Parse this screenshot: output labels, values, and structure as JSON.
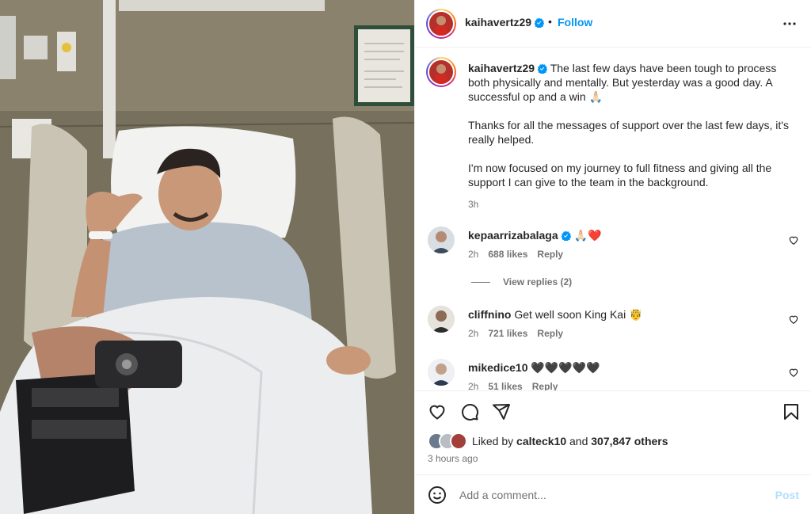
{
  "post": {
    "username": "kaihavertz29",
    "follow_label": "Follow",
    "separator": "•",
    "caption_paragraphs": [
      "The last few days have been tough to process both physically and mentally. But yesterday was a good day. A successful op and a win 🙏🏻",
      "Thanks for all the messages of support over the last few days, it's really helped.",
      "I'm now focused on my journey to full fitness and giving all the support I can give to the team in the background."
    ],
    "caption_time": "3h"
  },
  "comments": [
    {
      "username": "kepaarrizabalaga",
      "verified": true,
      "text": "🙏🏻❤️",
      "time": "2h",
      "likes": "688 likes",
      "reply": "Reply"
    },
    {
      "username": "cliffnino",
      "verified": false,
      "text": "Get well soon King Kai 🤴",
      "time": "2h",
      "likes": "721 likes",
      "reply": "Reply"
    },
    {
      "username": "mikedice10",
      "verified": false,
      "text": "🖤🖤🖤🖤🖤",
      "time": "2h",
      "likes": "51 likes",
      "reply": "Reply"
    }
  ],
  "view_replies": "View replies (2)",
  "likes": {
    "prefix": "Liked by",
    "user": "calteck10",
    "middle": "and",
    "count": "307,847 others"
  },
  "time_ago": "3 hours ago",
  "add_comment": {
    "placeholder": "Add a comment...",
    "post_label": "Post"
  },
  "colors": {
    "accent": "#0095f6",
    "verified": "#0095f6",
    "heart": "#ed4956",
    "post_disabled": "#b2dffc"
  },
  "icons": [
    "more-icon",
    "heart-icon",
    "comment-icon",
    "share-icon",
    "bookmark-icon",
    "emoji-icon",
    "verified-icon"
  ]
}
